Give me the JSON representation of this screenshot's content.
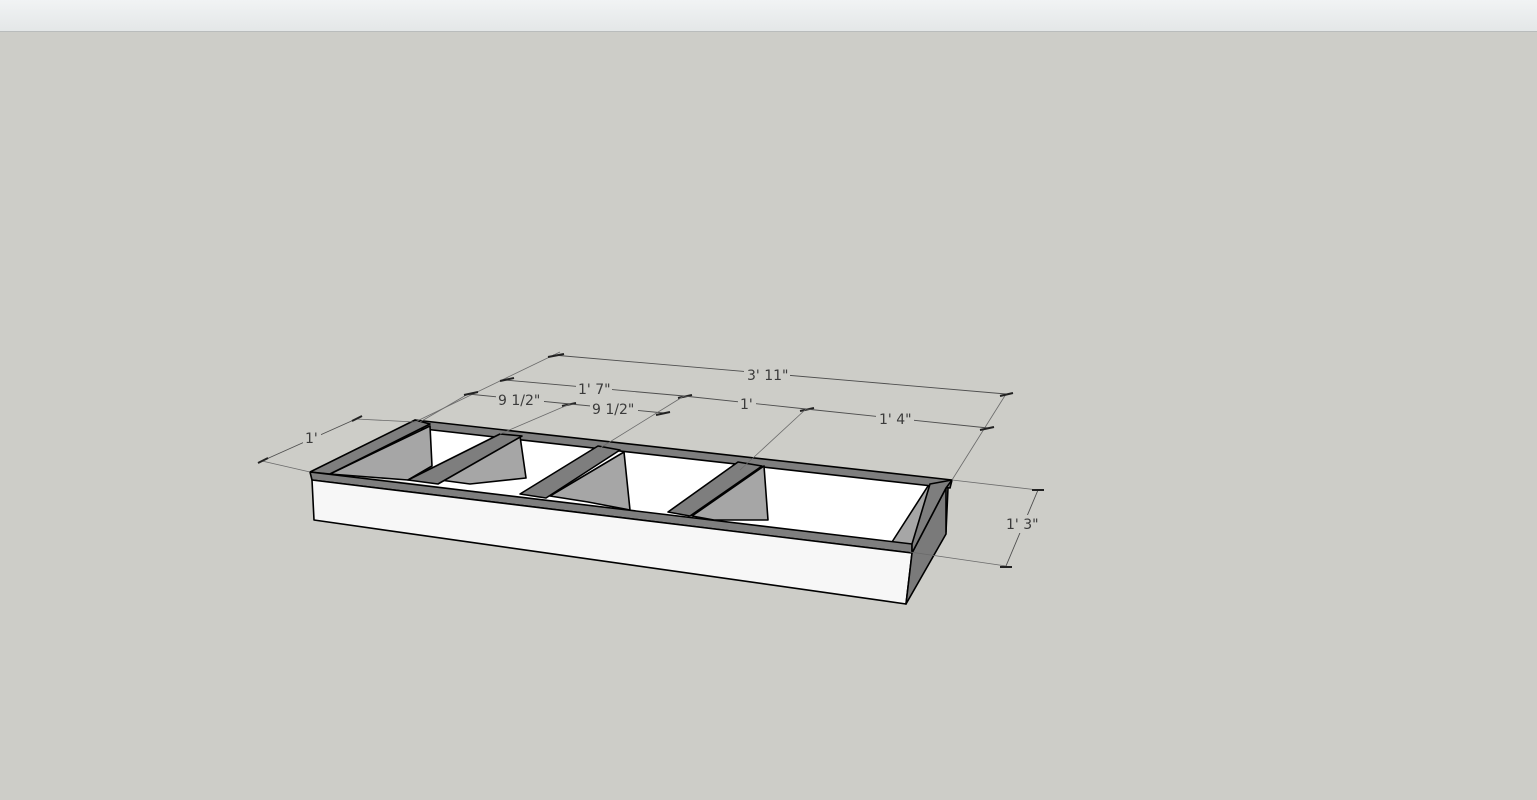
{
  "viewport": {
    "background": "#cdcdc8",
    "face_colors": {
      "front": "#f7f7f7",
      "top": "#7d7d7d",
      "inner": "#a7a7a7",
      "back_inner": "#ffffff"
    }
  },
  "dimensions": {
    "overall_length": "3' 11\"",
    "segment_1a": "9 1/2\"",
    "segment_1b": "9 1/2\"",
    "segment_1": "1' 7\"",
    "segment_2": "1'",
    "segment_3": "1' 4\"",
    "depth": "1'",
    "height": "1' 3\""
  }
}
